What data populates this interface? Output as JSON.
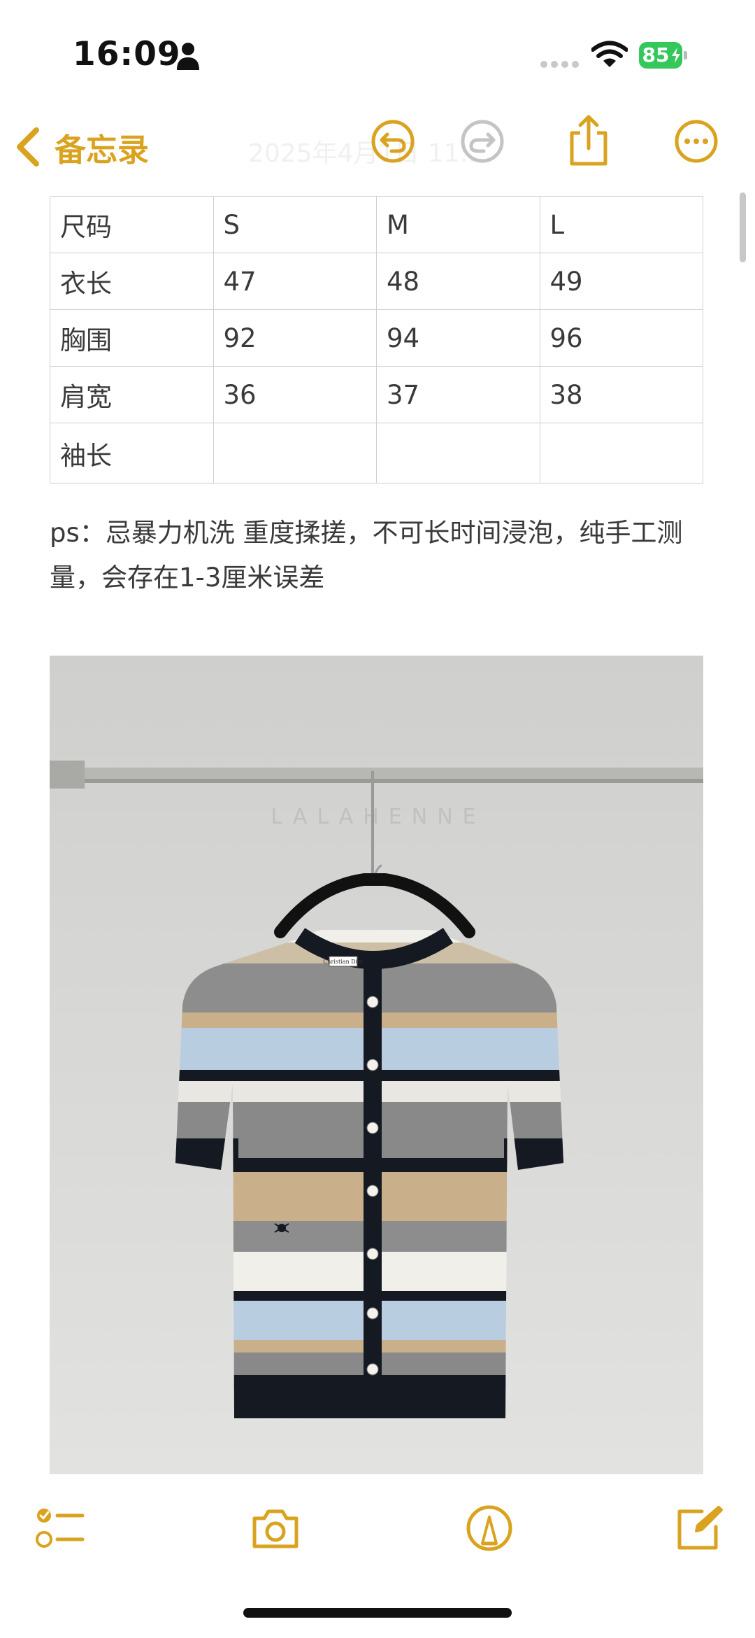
{
  "status_bar": {
    "time": "16:09",
    "battery": "85"
  },
  "nav": {
    "back_label": "备忘录",
    "title": "2025年4月1日 11:..."
  },
  "table": {
    "rows": [
      [
        "尺码",
        "S",
        "M",
        "L"
      ],
      [
        "衣长",
        "47",
        "48",
        "49"
      ],
      [
        "胸围",
        "92",
        "94",
        "96"
      ],
      [
        "肩宽",
        "36",
        "37",
        "38"
      ],
      [
        "袖长",
        "",
        "",
        ""
      ]
    ]
  },
  "note": "ps：忌暴力机洗 重度揉搓，不可长时间浸泡，纯手工测量，会存在1-3厘米误差",
  "photo": {
    "watermark": "LALAHENNE",
    "label": "Christian Dior"
  },
  "colors": {
    "accent": "#d9a31f",
    "battery": "#34c759"
  },
  "icons": [
    "person-icon",
    "cellular-signal-icon",
    "wifi-icon",
    "battery-icon",
    "back-chevron-icon",
    "undo-icon",
    "redo-icon",
    "share-icon",
    "more-icon",
    "checklist-icon",
    "camera-icon",
    "markup-icon",
    "compose-icon"
  ]
}
